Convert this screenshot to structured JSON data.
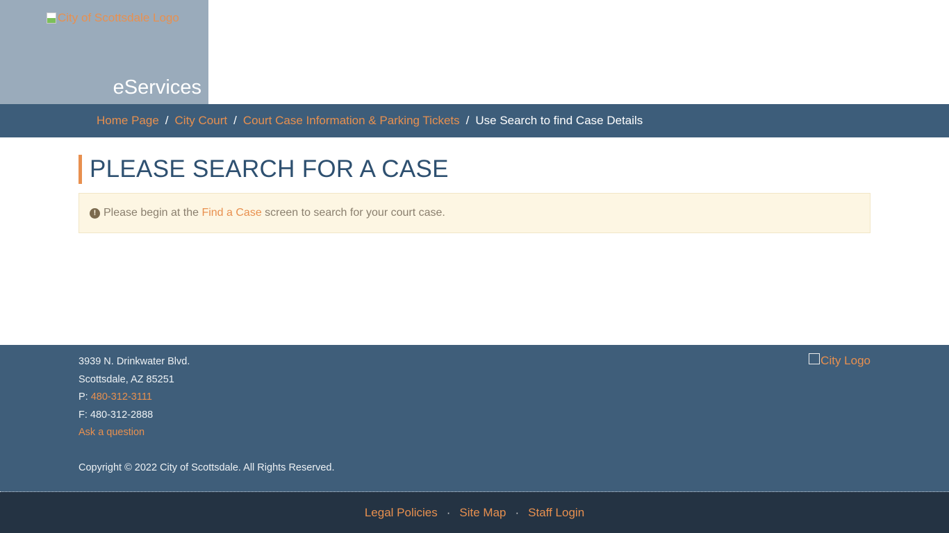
{
  "header": {
    "logo_alt": "City of Scottsdale Logo",
    "app_title": "eServices"
  },
  "breadcrumb": {
    "items": [
      "Home Page",
      "City Court",
      "Court Case Information & Parking Tickets"
    ],
    "current": "Use Search to find Case Details",
    "separator": "/"
  },
  "main": {
    "title": "PLEASE SEARCH FOR A CASE",
    "alert": {
      "icon": "exclamation-circle-icon",
      "before": "Please begin at the",
      "link": "Find a Case",
      "after": "screen to search for your court case."
    }
  },
  "footer": {
    "address1": "3939 N. Drinkwater Blvd.",
    "address2": "Scottsdale, AZ 85251",
    "phone_label": "P:",
    "phone": "480-312-3111",
    "fax": "F: 480-312-2888",
    "ask": "Ask a question",
    "copyright": "Copyright © 2022 City of Scottsdale. All Rights Reserved.",
    "city_logo_alt": "City Logo"
  },
  "bottom_links": [
    "Legal Policies",
    "Site Map",
    "Staff Login"
  ],
  "colors": {
    "accent": "#e8904f",
    "nav": "#3d5d7a",
    "footer": "#3f5e7a",
    "bottom": "#243343"
  }
}
